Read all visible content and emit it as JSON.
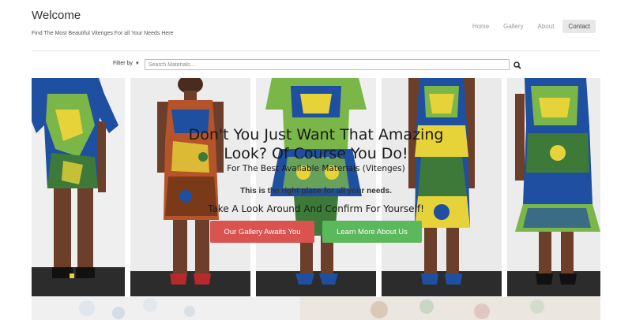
{
  "header": {
    "title": "Welcome",
    "tagline": "Find The Most Beautiful Vitenges For all Your Needs Here"
  },
  "nav": {
    "items": [
      "Home",
      "Gallery",
      "About",
      "Contact"
    ],
    "active": "Contact"
  },
  "search": {
    "filter_label": "Filter by",
    "placeholder": "Search Materials..."
  },
  "hero": {
    "heading_line1": "Don't You Just Want That Amazing",
    "heading_line2": "Look? Of Course You Do!",
    "subheading": "For The Best Available Materials (Vitenges)",
    "tagline": "This is the right place for all your needs.",
    "cta_text": "Take A Look Around And Confirm For Yourself!",
    "gallery_button": "Our Gallery Awaits You",
    "about_button": "Learn More About Us"
  },
  "colors": {
    "gallery_button": "#d9534f",
    "about_button": "#5cb85c",
    "nav_active_bg": "#e8e8e8",
    "fabric_blue": "#1f4fa0",
    "fabric_green": "#7ab648",
    "fabric_yellow": "#e6d33a",
    "fabric_orange": "#b5542a"
  }
}
